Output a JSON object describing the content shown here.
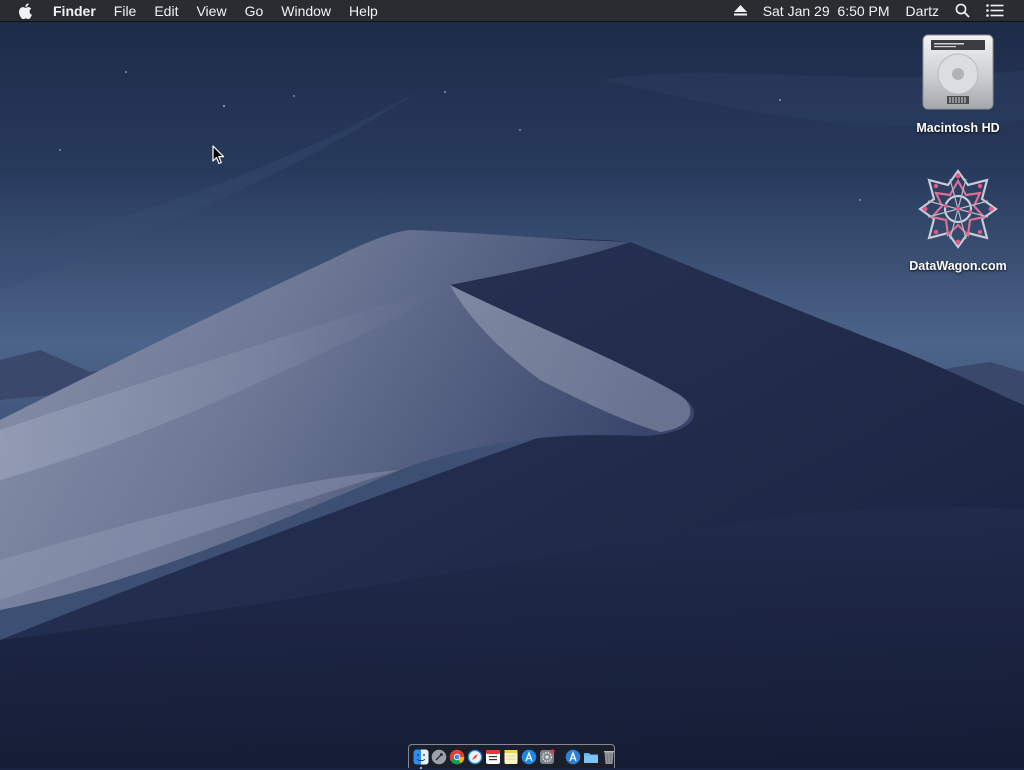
{
  "menubar": {
    "apple_icon": "apple-logo-icon",
    "app_name": "Finder",
    "menus": [
      "File",
      "Edit",
      "View",
      "Go",
      "Window",
      "Help"
    ],
    "eject_icon": "eject-icon",
    "clock": "Sat Jan 29  6:50 PM",
    "user_name": "Dartz",
    "spotlight_icon": "spotlight-search-icon",
    "notification_icon": "notification-center-icon"
  },
  "desktop": {
    "wallpaper": "macOS Mojave night sand dunes",
    "icons": [
      {
        "label": "Macintosh HD",
        "icon": "hard-drive-icon"
      },
      {
        "label": "DataWagon.com",
        "icon": "datawagon-logo-icon"
      }
    ]
  },
  "dock": {
    "apps": [
      {
        "name": "Finder",
        "icon": "finder-icon",
        "running": true
      },
      {
        "name": "Launchpad",
        "icon": "launchpad-icon"
      },
      {
        "name": "Chrome",
        "icon": "chrome-icon"
      },
      {
        "name": "Safari",
        "icon": "safari-icon"
      },
      {
        "name": "Calendar",
        "icon": "calendar-icon"
      },
      {
        "name": "Notes",
        "icon": "notes-icon"
      },
      {
        "name": "App Store",
        "icon": "app-store-icon"
      },
      {
        "name": "System Preferences",
        "icon": "system-preferences-icon"
      },
      {
        "name": "Applications",
        "icon": "applications-folder-icon"
      },
      {
        "name": "Downloads",
        "icon": "downloads-folder-icon"
      },
      {
        "name": "Trash",
        "icon": "trash-icon"
      }
    ]
  },
  "colors": {
    "menubar_bg": "#2a2c31",
    "sky_top": "#1e2b47",
    "sky_horizon": "#4c6489",
    "dune_light": "#8c95ad",
    "dune_dark": "#1b2444"
  }
}
